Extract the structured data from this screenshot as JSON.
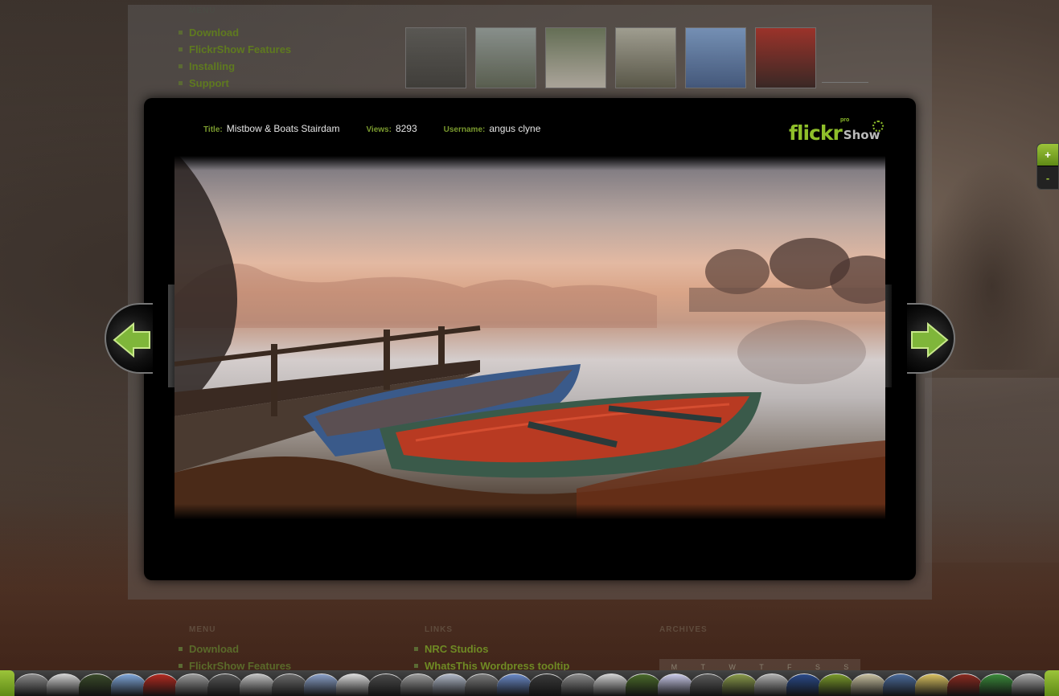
{
  "menu": {
    "heading": "MENU",
    "items": [
      {
        "label": "Download"
      },
      {
        "label": "FlickrShow Features"
      },
      {
        "label": "Installing"
      },
      {
        "label": "Support"
      }
    ]
  },
  "thumbnails": [
    {
      "colors": [
        "#5c5c58",
        "#3a3a36"
      ],
      "name": "pagoda"
    },
    {
      "colors": [
        "#9aa6a2",
        "#5b6452"
      ],
      "name": "lake-house"
    },
    {
      "colors": [
        "#6a7a5a",
        "#c8c2b6"
      ],
      "name": "torii-path"
    },
    {
      "colors": [
        "#b8b8a8",
        "#5a5a48"
      ],
      "name": "stone-gate"
    },
    {
      "colors": [
        "#7fa6d8",
        "#3d5a8a"
      ],
      "name": "temple-roof"
    },
    {
      "colors": [
        "#b22a20",
        "#2e1a18"
      ],
      "name": "red-gate"
    }
  ],
  "photo_info": {
    "title_label": "Title:",
    "title": "Mistbow & Boats Stairdam",
    "views_label": "Views:",
    "views": "8293",
    "username_label": "Username:",
    "username": "angus clyne"
  },
  "logo": {
    "flickr": "flickr",
    "show": "Show",
    "pro": "pro"
  },
  "zoom": {
    "in_label": "+",
    "out_label": "-"
  },
  "footer": {
    "col1": {
      "heading": "MENU",
      "items": [
        {
          "label": "Download"
        },
        {
          "label": "FlickrShow Features"
        }
      ]
    },
    "col2": {
      "heading": "LINKS",
      "items": [
        {
          "label": "NRC Studios"
        },
        {
          "label": "WhatsThis Wordpress tooltip"
        }
      ]
    },
    "col3": {
      "heading": "ARCHIVES",
      "calendar": [
        "M",
        "T",
        "W",
        "T",
        "F",
        "S",
        "S"
      ]
    }
  },
  "carousel": {
    "colors": [
      "#8a8a8a",
      "#cfcfcf",
      "#3a4a2a",
      "#7fa6d8",
      "#b22a20",
      "#9a9a9a",
      "#555",
      "#c0c0c0",
      "#6a6a6a",
      "#8aa0c8",
      "#d8d8d8",
      "#4a4a4a",
      "#9a9a9a",
      "#b0b8c8",
      "#7a7a7a",
      "#6a8ac8",
      "#3a3a3a",
      "#8a8a8a",
      "#cfcfcf",
      "#4a6a2a",
      "#c8c8e8",
      "#5a5a5a",
      "#8a9a4a",
      "#b0b0b0",
      "#2a4a8a",
      "#7a9a2a",
      "#c8c0a0",
      "#4a6a9a",
      "#d8c060",
      "#8a2a20",
      "#3a8a3a",
      "#a8a8a8",
      "#5a7a9a",
      "#2a6a8a",
      "#6a6a6a",
      "#c04a20",
      "#3a7a2a",
      "#2a2a2a"
    ]
  },
  "colors": {
    "accent": "#8fbf2a",
    "label": "#7a9a2e",
    "lightbox_bg": "#000000"
  }
}
